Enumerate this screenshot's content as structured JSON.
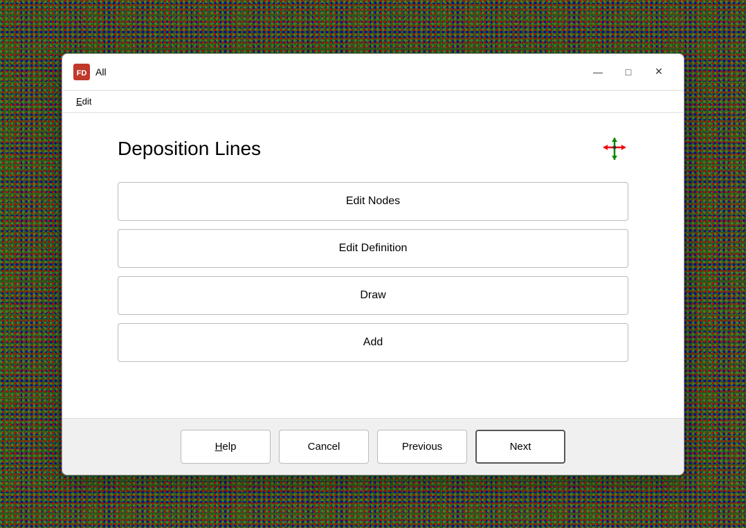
{
  "background": {
    "color": "#2a5a1a"
  },
  "dialog": {
    "title": "All",
    "icon_label": "FD-icon",
    "minimize_label": "—",
    "maximize_label": "□",
    "close_label": "✕",
    "menu": {
      "items": [
        {
          "label": "Edit",
          "underline_index": 0
        }
      ]
    },
    "content": {
      "section_title": "Deposition Lines",
      "buttons": [
        {
          "label": "Edit Nodes"
        },
        {
          "label": "Edit Definition"
        },
        {
          "label": "Draw"
        },
        {
          "label": "Add"
        }
      ]
    },
    "footer": {
      "buttons": [
        {
          "label": "Help",
          "underline_char": "H"
        },
        {
          "label": "Cancel"
        },
        {
          "label": "Previous"
        },
        {
          "label": "Next",
          "emphasized": true
        }
      ]
    }
  }
}
